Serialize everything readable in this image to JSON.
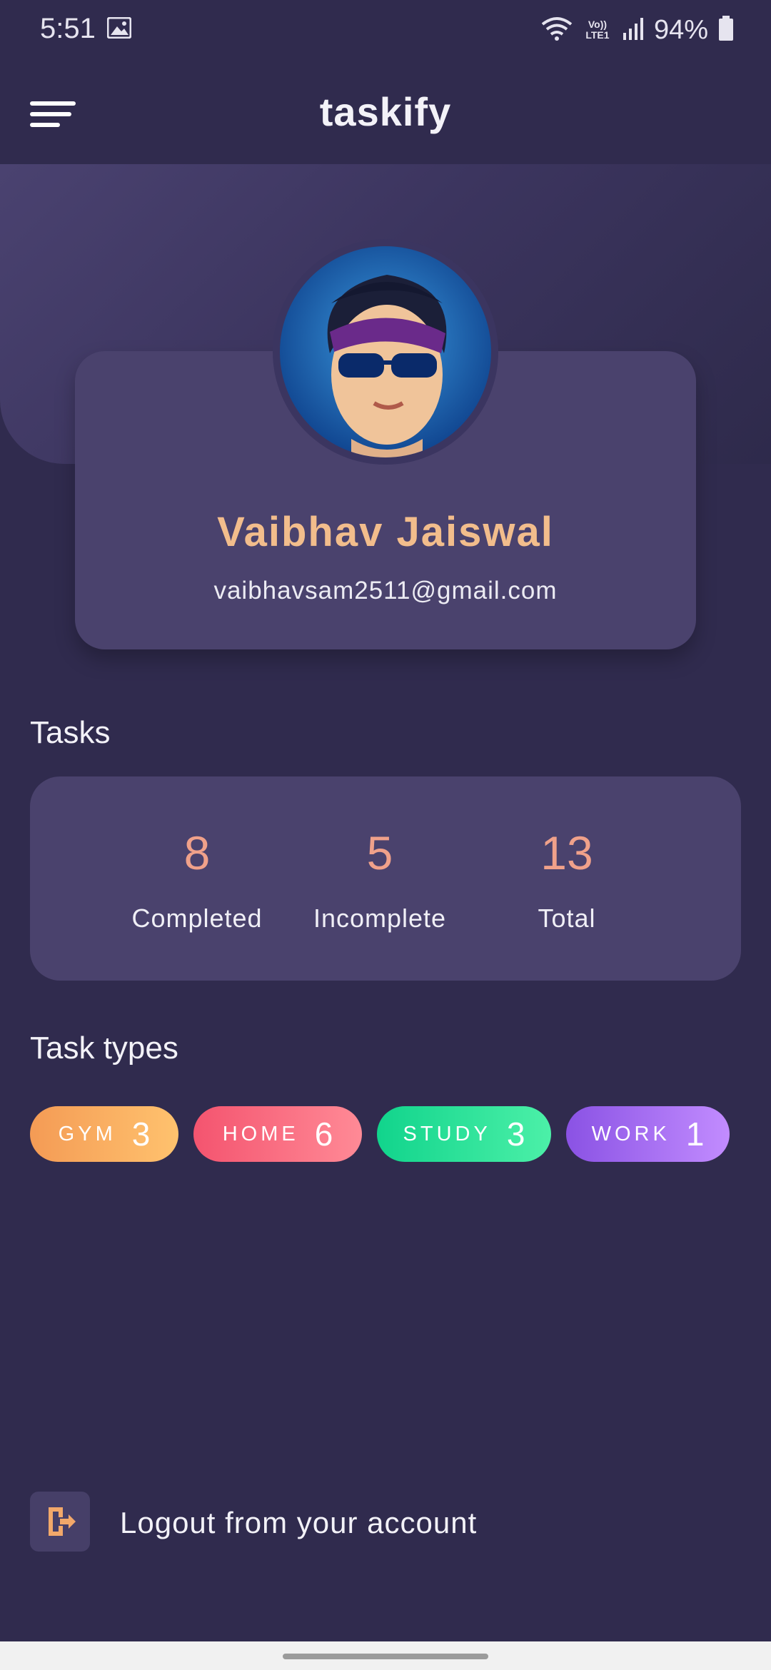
{
  "status_bar": {
    "time": "5:51",
    "battery": "94%",
    "network_label": "Vo)) LTE1"
  },
  "header": {
    "app_title": "taskify"
  },
  "profile": {
    "name": "Vaibhav Jaiswal",
    "email": "vaibhavsam2511@gmail.com"
  },
  "tasks": {
    "title": "Tasks",
    "stats": [
      {
        "value": "8",
        "label": "Completed"
      },
      {
        "value": "5",
        "label": "Incomplete"
      },
      {
        "value": "13",
        "label": "Total"
      }
    ]
  },
  "task_types": {
    "title": "Task types",
    "items": [
      {
        "label": "GYM",
        "count": "3",
        "color_from": "#f49b55",
        "color_to": "#ffc26e"
      },
      {
        "label": "HOME",
        "count": "6",
        "color_from": "#f4546f",
        "color_to": "#ff8a96"
      },
      {
        "label": "STUDY",
        "count": "3",
        "color_from": "#11d48c",
        "color_to": "#4cf0a8"
      },
      {
        "label": "WORK",
        "count": "1",
        "color_from": "#8a52e4",
        "color_to": "#c28cff"
      }
    ]
  },
  "logout": {
    "label": "Logout from your account"
  },
  "colors": {
    "background": "#302b4e",
    "card": "#4a426d",
    "name_accent": "#f2bd8c",
    "stat_accent": "#f0a18a"
  }
}
